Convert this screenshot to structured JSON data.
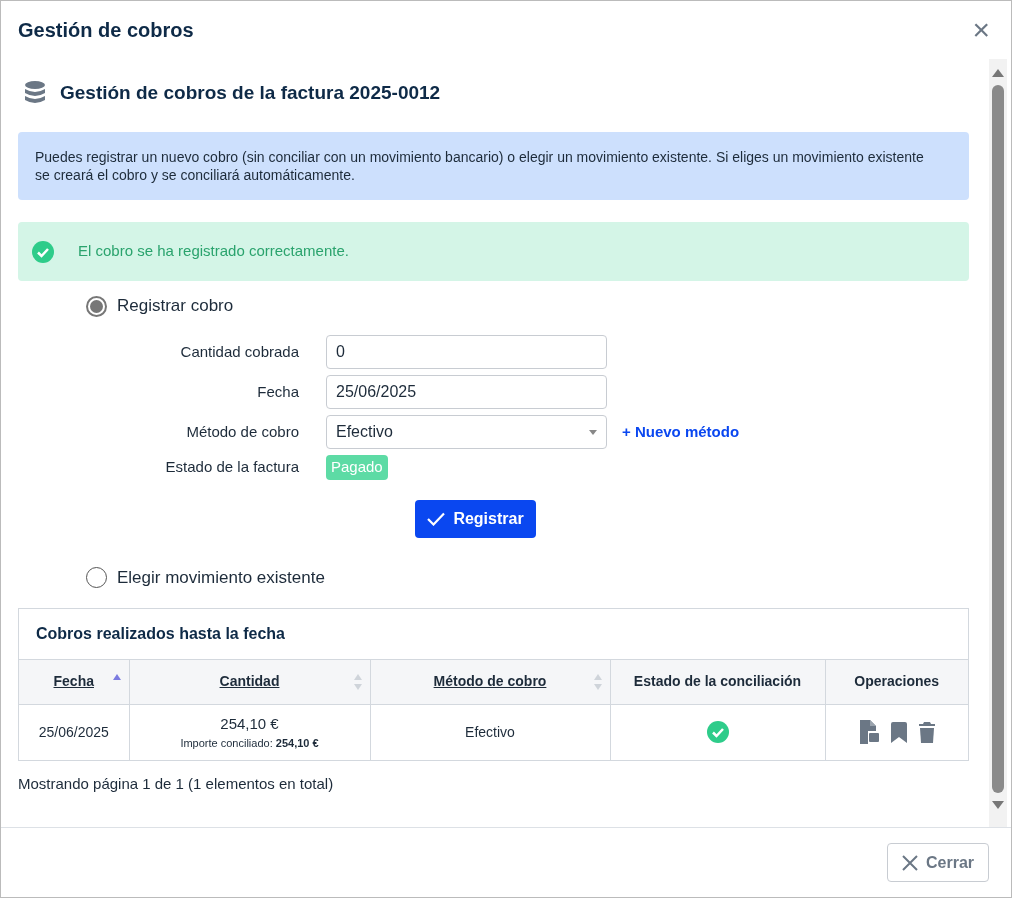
{
  "dialog": {
    "title": "Gestión de cobros",
    "close_symbol": "×"
  },
  "heading": "Gestión de cobros de la factura 2025-0012",
  "info": "Puedes registrar un nuevo cobro (sin conciliar con un movimiento bancario) o elegir un movimiento existente. Si eliges un movimiento existente se creará el cobro y se conciliará automáticamente.",
  "success": "El cobro se ha registrado correctamente.",
  "options": [
    {
      "label": "Registrar cobro",
      "selected": true
    },
    {
      "label": "Elegir movimiento existente",
      "selected": false
    }
  ],
  "form": {
    "fields": [
      {
        "kind": "input",
        "label": "Cantidad cobrada",
        "value": "0"
      },
      {
        "kind": "input",
        "label": "Fecha",
        "value": "25/06/2025"
      },
      {
        "kind": "select",
        "label": "Método de cobro",
        "value": "Efectivo",
        "link": "+ Nuevo método"
      },
      {
        "kind": "badge",
        "label": "Estado de la factura",
        "value": "Pagado",
        "color": "#5ddba5"
      }
    ],
    "submit": "Registrar"
  },
  "table": {
    "title": "Cobros realizados hasta la fecha",
    "columns": [
      {
        "label": "Fecha",
        "sortable": true,
        "sorted": true
      },
      {
        "label": "Cantidad",
        "sortable": true,
        "sorted": false
      },
      {
        "label": "Método de cobro",
        "sortable": true,
        "sorted": false
      },
      {
        "label": "Estado de la conciliación",
        "sortable": false
      },
      {
        "label": "Operaciones",
        "sortable": false
      }
    ],
    "rows": [
      {
        "fecha": "25/06/2025",
        "cantidad": "254,10 €",
        "conciliado": "Importe conciliado: **254,10 €**",
        "metodo": "Efectivo",
        "reconciled": true
      }
    ],
    "footer": "Mostrando página 1 de 1 (1 elementos en total)"
  },
  "close_button": "Cerrar"
}
